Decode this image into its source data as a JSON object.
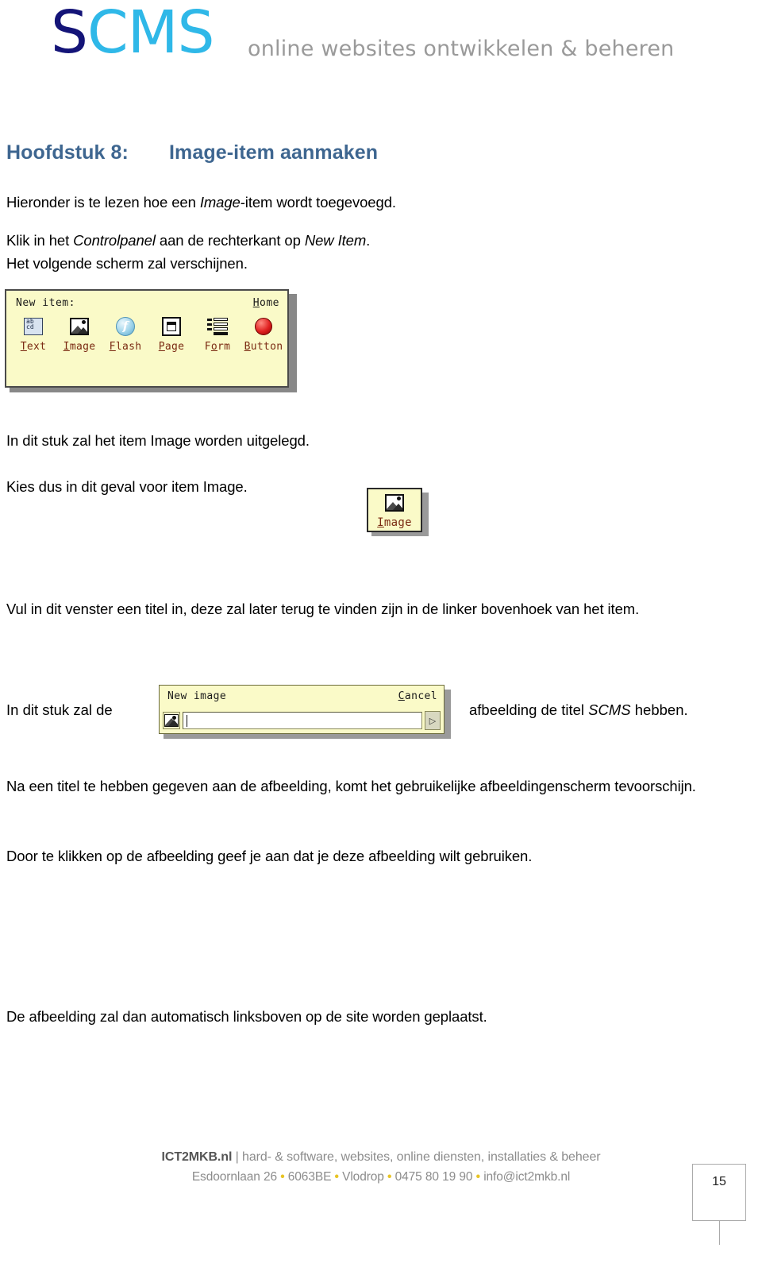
{
  "header": {
    "logo_primary": "S",
    "logo_secondary": "CMS",
    "tagline": "online websites ontwikkelen & beheren",
    "colors": {
      "logo_primary": "#141478",
      "logo_secondary": "#2fb8e8",
      "tagline": "#9a9a9a"
    }
  },
  "chapter": {
    "number_label": "Hoofdstuk 8:",
    "title": "Image-item aanmaken",
    "color": "#3e6690"
  },
  "body": {
    "p_intro_a": "Hieronder is te lezen hoe een ",
    "p_intro_em": "Image",
    "p_intro_b": "-item wordt toegevoegd.",
    "p_klik_a": "Klik in het ",
    "p_klik_em1": "Controlpanel",
    "p_klik_b": " aan de rechterkant op ",
    "p_klik_em2": "New Item",
    "p_klik_c": ".",
    "p_klik_line2": "Het volgende scherm zal verschijnen.",
    "p_uitleg": "In dit stuk zal het item Image worden uitgelegd.",
    "p_kies": "Kies dus in dit geval voor item Image.",
    "p_vul": "Vul in dit venster een titel in, deze zal later terug te vinden zijn in de linker bovenhoek van het item.",
    "p_inline_left": "In dit stuk zal de",
    "p_inline_right_a": "afbeelding de titel ",
    "p_inline_right_em": "SCMS",
    "p_inline_right_b": " hebben.",
    "p_na": "Na een titel te hebben gegeven aan de afbeelding, komt het gebruikelijke afbeeldingenscherm tevoorschijn.",
    "p_door": "Door te klikken op de afbeelding geef je aan dat je deze afbeelding wilt gebruiken.",
    "p_auto": "De afbeelding zal dan automatisch linksboven op de site worden geplaatst."
  },
  "toolbar_screenshot": {
    "new_item_label": "New item:",
    "home_accel": "H",
    "home_rest": "ome",
    "background": "#fafac8",
    "label_color": "#7a2a12",
    "items": [
      {
        "accel": "T",
        "rest": "ext",
        "icon": "text-grid-icon"
      },
      {
        "accel": "I",
        "rest": "mage",
        "icon": "picture-icon"
      },
      {
        "accel": "F",
        "rest": "lash",
        "icon": "flash-circle-icon"
      },
      {
        "accel": "P",
        "rest": "age",
        "icon": "page-frame-icon"
      },
      {
        "accel": "F",
        "rest": "orm",
        "icon": "form-list-icon",
        "accel_pos": 1,
        "pre": "F",
        "mid": "o",
        "post": "rm"
      },
      {
        "accel": "B",
        "rest": "utton",
        "icon": "red-button-icon"
      }
    ]
  },
  "image_button_screenshot": {
    "accel": "I",
    "rest": "mage",
    "icon": "picture-icon"
  },
  "new_image_dialog": {
    "title": "New image",
    "cancel_accel": "C",
    "cancel_rest": "ancel",
    "input_value": "",
    "go_glyph": "▷",
    "icon": "picture-icon"
  },
  "footer": {
    "brand": "ICT2MKB.nl",
    "separator": " | ",
    "services": "hard- &  software, websites, online diensten, installaties & beheer",
    "address_street": "Esdoornlaan 26",
    "address_zip": "6063BE",
    "address_city": "Vlodrop",
    "phone": "0475 80 19 90",
    "email": "info@ict2mkb.nl",
    "bullet": "•",
    "bullet_color": "#e8c425",
    "page_number": "15"
  }
}
